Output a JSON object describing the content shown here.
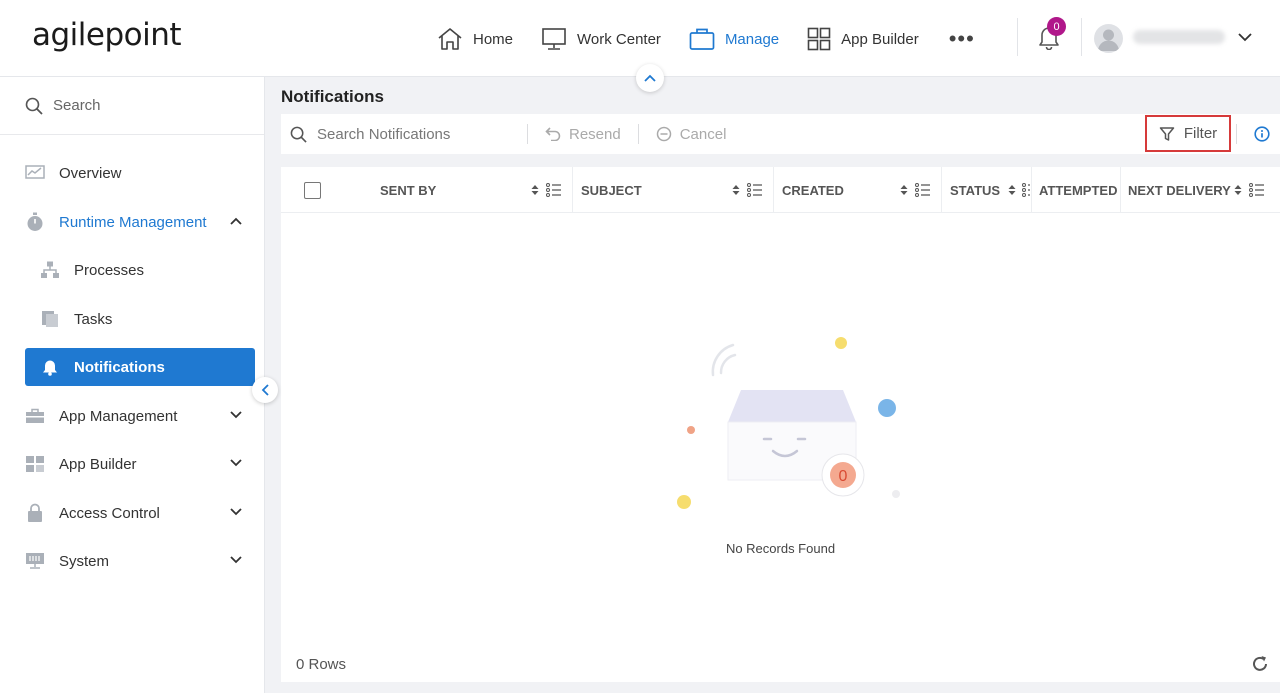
{
  "header": {
    "logo": "agilepoint",
    "nav": [
      {
        "label": "Home",
        "icon": "home-icon"
      },
      {
        "label": "Work Center",
        "icon": "monitor-icon"
      },
      {
        "label": "Manage",
        "icon": "briefcase-icon",
        "active": true
      },
      {
        "label": "App Builder",
        "icon": "grid-icon"
      }
    ],
    "more": "•••",
    "notification_count": "0",
    "accent_color": "#1f79d1",
    "badge_color": "#b0178a"
  },
  "sidebar": {
    "search_placeholder": "Search",
    "items": [
      {
        "label": "Overview",
        "icon": "chart-icon"
      },
      {
        "label": "Runtime Management",
        "icon": "stopwatch-icon",
        "expanded": true
      },
      {
        "label": "Processes",
        "icon": "hierarchy-icon"
      },
      {
        "label": "Tasks",
        "icon": "pages-icon"
      },
      {
        "label": "Notifications",
        "icon": "bell-icon",
        "selected": true
      },
      {
        "label": "App Management",
        "icon": "toolbox-icon"
      },
      {
        "label": "App Builder",
        "icon": "grid-icon"
      },
      {
        "label": "Access Control",
        "icon": "lock-icon"
      },
      {
        "label": "System",
        "icon": "server-icon"
      }
    ]
  },
  "main": {
    "title": "Notifications",
    "toolbar": {
      "search_placeholder": "Search Notifications",
      "resend": "Resend",
      "cancel": "Cancel",
      "filter": "Filter"
    },
    "columns": [
      "SENT BY",
      "SUBJECT",
      "CREATED",
      "STATUS",
      "ATTEMPTED",
      "NEXT DELIVERY"
    ],
    "empty_badge": "0",
    "empty_message": "No Records Found",
    "rows_count": "0 Rows"
  }
}
